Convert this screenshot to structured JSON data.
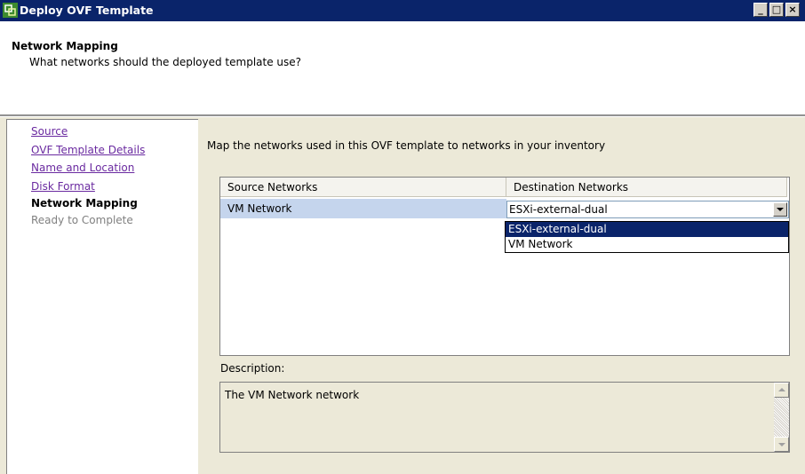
{
  "window": {
    "title": "Deploy OVF Template",
    "buttons": {
      "minimize": "_",
      "maximize": "□",
      "close": "×"
    }
  },
  "header": {
    "title": "Network Mapping",
    "subtitle": "What networks should the deployed template use?"
  },
  "steps": [
    {
      "label": "Source",
      "state": "link"
    },
    {
      "label": "OVF Template Details",
      "state": "link"
    },
    {
      "label": "Name and Location",
      "state": "link"
    },
    {
      "label": "Disk Format",
      "state": "link"
    },
    {
      "label": "Network Mapping",
      "state": "current"
    },
    {
      "label": "Ready to Complete",
      "state": "pending"
    }
  ],
  "main": {
    "instruction": "Map the networks used in this OVF template to networks in your inventory",
    "table": {
      "columns": [
        "Source Networks",
        "Destination Networks"
      ],
      "rows": [
        {
          "source": "VM Network",
          "destination": "ESXi-external-dual"
        }
      ]
    },
    "dropdown": {
      "options": [
        "ESXi-external-dual",
        "VM Network"
      ],
      "selected": "ESXi-external-dual"
    },
    "description_label": "Description:",
    "description_text": "The VM Network network"
  },
  "colors": {
    "titlebar": "#0a246a",
    "selection": "#0a246a",
    "row_highlight": "#c5d5ed",
    "link": "#6a2aa0"
  }
}
